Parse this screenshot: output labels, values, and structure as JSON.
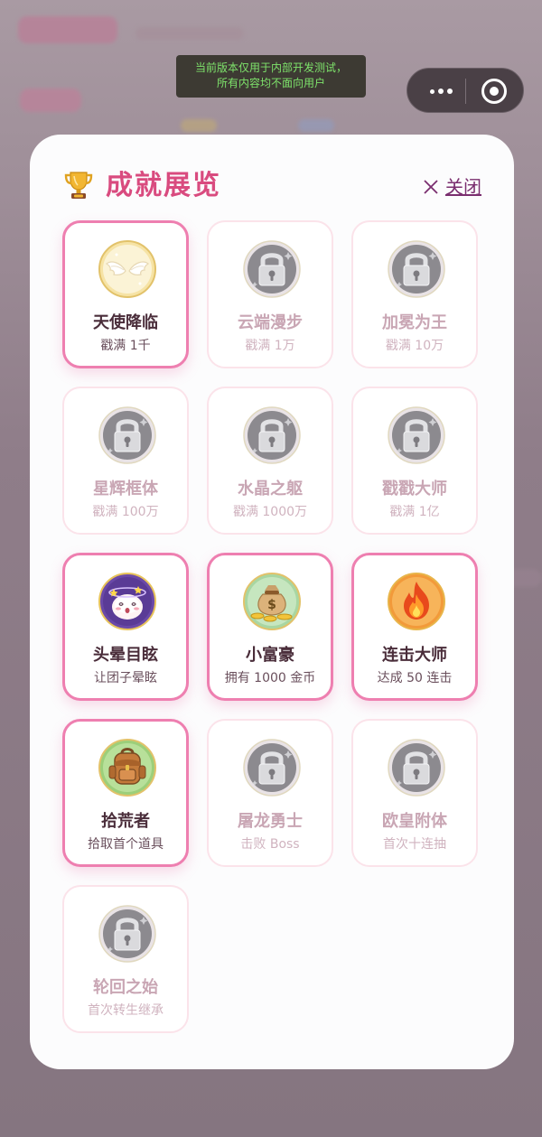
{
  "notice": {
    "line1": "当前版本仅用于内部开发测试，",
    "line2": "所有内容均不面向用户"
  },
  "modal": {
    "title": "成就展览",
    "title_icon": "trophy-icon",
    "close_label": "关闭"
  },
  "colors": {
    "title": "#d94b7f",
    "unlocked_border": "#ee7fb0",
    "locked_border": "#fbe3ea",
    "locked_text": "#c9a6b4"
  },
  "achievements": [
    {
      "name": "天使降临",
      "desc": "戳满 1千",
      "unlocked": true,
      "icon": "angel-wings-icon"
    },
    {
      "name": "云端漫步",
      "desc": "戳满 1万",
      "unlocked": false,
      "icon": "lock-icon"
    },
    {
      "name": "加冕为王",
      "desc": "戳满 10万",
      "unlocked": false,
      "icon": "lock-icon"
    },
    {
      "name": "星辉框体",
      "desc": "戳满 100万",
      "unlocked": false,
      "icon": "lock-icon"
    },
    {
      "name": "水晶之躯",
      "desc": "戳满 1000万",
      "unlocked": false,
      "icon": "lock-icon"
    },
    {
      "name": "戳戳大师",
      "desc": "戳满 1亿",
      "unlocked": false,
      "icon": "lock-icon"
    },
    {
      "name": "头晕目眩",
      "desc": "让团子晕眩",
      "unlocked": true,
      "icon": "dizzy-dumpling-icon"
    },
    {
      "name": "小富豪",
      "desc": "拥有 1000 金币",
      "unlocked": true,
      "icon": "money-bag-icon"
    },
    {
      "name": "连击大师",
      "desc": "达成 50 连击",
      "unlocked": true,
      "icon": "fire-icon"
    },
    {
      "name": "拾荒者",
      "desc": "拾取首个道具",
      "unlocked": true,
      "icon": "backpack-icon"
    },
    {
      "name": "屠龙勇士",
      "desc": "击败 Boss",
      "unlocked": false,
      "icon": "lock-icon"
    },
    {
      "name": "欧皇附体",
      "desc": "首次十连抽",
      "unlocked": false,
      "icon": "lock-icon"
    },
    {
      "name": "轮回之始",
      "desc": "首次转生继承",
      "unlocked": false,
      "icon": "lock-icon"
    }
  ]
}
